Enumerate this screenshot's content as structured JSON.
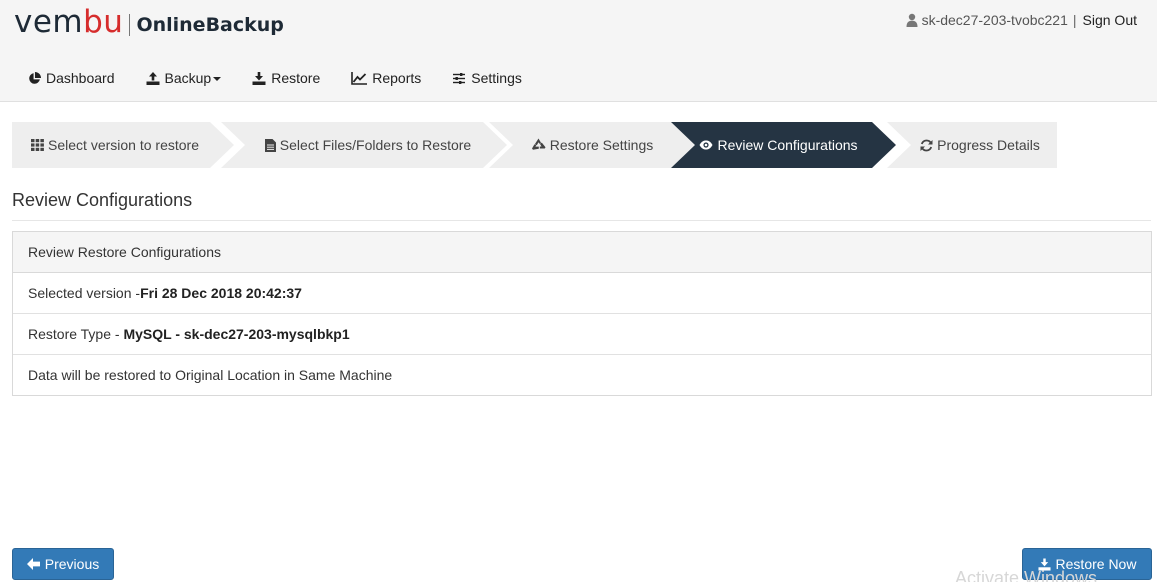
{
  "brand": {
    "logo_text_start": "vem",
    "logo_text_accent": "bu",
    "product": "OnlineBackup"
  },
  "user": {
    "name": "sk-dec27-203-tvobc221",
    "separator": "|",
    "signout_label": "Sign Out"
  },
  "nav": {
    "items": [
      {
        "label": "Dashboard",
        "icon": "pie-chart-icon"
      },
      {
        "label": "Backup",
        "icon": "upload-icon",
        "has_dropdown": true
      },
      {
        "label": "Restore",
        "icon": "download-icon"
      },
      {
        "label": "Reports",
        "icon": "line-chart-icon"
      },
      {
        "label": "Settings",
        "icon": "sliders-icon"
      }
    ]
  },
  "wizard": {
    "steps": [
      {
        "label": "Select version to restore",
        "icon": "grid-icon",
        "active": false
      },
      {
        "label": "Select Files/Folders to Restore",
        "icon": "file-icon",
        "active": false
      },
      {
        "label": "Restore Settings",
        "icon": "recycle-icon",
        "active": false
      },
      {
        "label": "Review Configurations",
        "icon": "eye-icon",
        "active": true
      },
      {
        "label": "Progress Details",
        "icon": "refresh-icon",
        "active": false
      }
    ]
  },
  "page": {
    "title": "Review Configurations"
  },
  "panel": {
    "heading": "Review Restore Configurations",
    "version_prefix": "Selected version -",
    "version_value": "Fri 28 Dec 2018 20:42:37",
    "restore_type_prefix": "Restore Type - ",
    "restore_type_value": "MySQL - sk-dec27-203-mysqlbkp1",
    "destination_text": "Data will be restored to Original Location in Same Machine"
  },
  "buttons": {
    "previous_label": "Previous",
    "restore_now_label": "Restore Now"
  },
  "watermark": "Activate Windows",
  "colors": {
    "primary": "#337ab7",
    "active_step": "#253443",
    "inactive_step": "#eeeeee",
    "brand_accent": "#d62c2c"
  }
}
